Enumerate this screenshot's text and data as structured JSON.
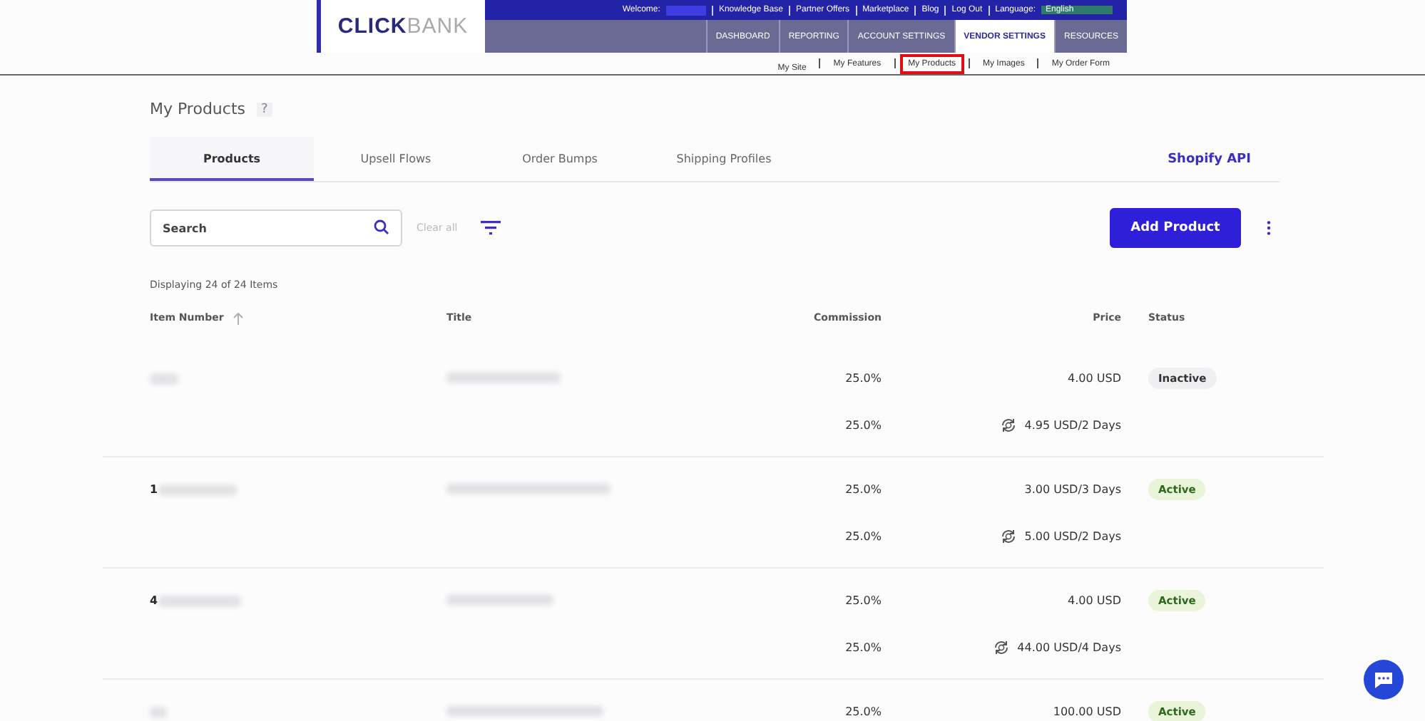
{
  "header": {
    "logo": "CLICKBANK",
    "welcome": "Welcome:",
    "top_links": [
      "Knowledge Base",
      "Partner Offers",
      "Marketplace",
      "Blog",
      "Log Out"
    ],
    "language_label": "Language:",
    "language_value": "English",
    "nav": [
      {
        "label": "DASHBOARD",
        "selected": false
      },
      {
        "label": "REPORTING",
        "selected": false
      },
      {
        "label": "ACCOUNT SETTINGS",
        "selected": false
      },
      {
        "label": "VENDOR SETTINGS",
        "selected": true
      },
      {
        "label": "RESOURCES",
        "selected": false
      }
    ],
    "subnav": [
      {
        "label": "My Site",
        "selected": false
      },
      {
        "label": "My Features",
        "selected": false
      },
      {
        "label": "My Products",
        "selected": true
      },
      {
        "label": "My Images",
        "selected": false
      },
      {
        "label": "My Order Form",
        "selected": false
      }
    ]
  },
  "page_title": "My Products",
  "help": "?",
  "tabs": [
    {
      "label": "Products",
      "selected": true
    },
    {
      "label": "Upsell Flows",
      "selected": false
    },
    {
      "label": "Order Bumps",
      "selected": false
    },
    {
      "label": "Shipping Profiles",
      "selected": false
    }
  ],
  "shopify_link": "Shopify API",
  "search": {
    "placeholder": "Search"
  },
  "clear_all": "Clear all",
  "add_button": "Add Product",
  "count": "Displaying 24 of 24 Items",
  "columns": [
    "Item Number",
    "Title",
    "Commission",
    "Price",
    "Status"
  ],
  "rows": [
    {
      "item_number": "",
      "status": {
        "label": "Inactive",
        "kind": "inactive"
      },
      "prices": [
        {
          "commission": "25.0%",
          "price": "4.00 USD",
          "recurring": false
        },
        {
          "commission": "25.0%",
          "price": "4.95 USD/2 Days",
          "recurring": true
        }
      ]
    },
    {
      "item_number": "1",
      "status": {
        "label": "Active",
        "kind": "active"
      },
      "prices": [
        {
          "commission": "25.0%",
          "price": "3.00 USD/3 Days",
          "recurring": false
        },
        {
          "commission": "25.0%",
          "price": "5.00 USD/2 Days",
          "recurring": true
        }
      ]
    },
    {
      "item_number": "4",
      "status": {
        "label": "Active",
        "kind": "active"
      },
      "prices": [
        {
          "commission": "25.0%",
          "price": "4.00 USD",
          "recurring": false
        },
        {
          "commission": "25.0%",
          "price": "44.00 USD/4 Days",
          "recurring": true
        }
      ]
    },
    {
      "item_number": "",
      "status": {
        "label": "Active",
        "kind": "active"
      },
      "prices": [
        {
          "commission": "25.0%",
          "price": "100.00 USD",
          "recurring": false
        }
      ]
    }
  ]
}
